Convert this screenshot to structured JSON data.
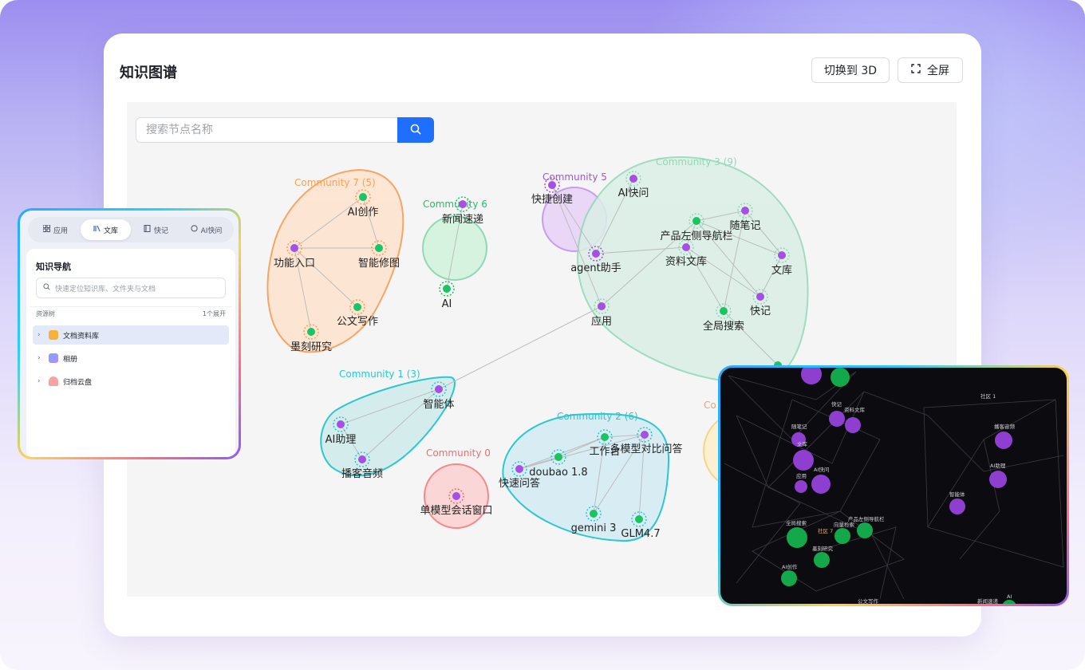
{
  "header": {
    "title": "知识图谱",
    "switch_3d_label": "切换到 3D",
    "fullscreen_label": "全屏"
  },
  "search": {
    "placeholder": "搜索节点名称"
  },
  "colors": {
    "accent": "#1f6fff",
    "purple_node": "#a64fe6",
    "green_node": "#19c463"
  },
  "communities": [
    {
      "label": "Community 0",
      "color": "#f36c6c",
      "nodes": [
        "单模型会话窗口"
      ]
    },
    {
      "label": "Community 1 (3)",
      "color": "#2cc7cf",
      "nodes": [
        "智能体",
        "AI助理",
        "播客音频"
      ]
    },
    {
      "label": "Community 2 (6)",
      "color": "#2cc7cf",
      "nodes": [
        "doubao 1.8",
        "工作台",
        "多模型对比问答",
        "快速问答",
        "gemini 3",
        "GLM4.7"
      ]
    },
    {
      "label": "Community 3 (9)",
      "color": "#8fd9b6",
      "nodes": [
        "AI快问",
        "产品左侧导航栏",
        "随笔记",
        "资料文库",
        "文库",
        "应用",
        "快记",
        "全局搜索"
      ]
    },
    {
      "label": "Community 5",
      "color": "#a64fe6",
      "nodes": [
        "快捷创建",
        "agent助手"
      ]
    },
    {
      "label": "Community 6",
      "color": "#19c463",
      "nodes": [
        "新闻速递",
        "AI"
      ]
    },
    {
      "label": "Community 7 (5)",
      "color": "#f5a25d",
      "nodes": [
        "AI创作",
        "功能入口",
        "智能修图",
        "公文写作",
        "墨刻研究"
      ]
    }
  ],
  "side_panel": {
    "tabs": [
      "应用",
      "文库",
      "快记",
      "AI快问"
    ],
    "active_tab": "文库",
    "nav_title": "知识导航",
    "nav_search_placeholder": "快速定位知识库、文件夹与文档",
    "tree_label": "资源树",
    "tree_meta": "1个展开",
    "tree_items": [
      "文档资料库",
      "相册",
      "归档云盘"
    ]
  },
  "dark_panel": {
    "labels": [
      "快记",
      "资料文库",
      "随笔记",
      "文库",
      "AI快问",
      "应用",
      "社区 1",
      "播客音频",
      "AI助理",
      "智能体",
      "全局搜索",
      "产品左侧导航栏",
      "向量检索",
      "社区 7",
      "墨刻研究",
      "AI创作",
      "公文写作",
      "新闻速递",
      "AI",
      "Co"
    ]
  }
}
